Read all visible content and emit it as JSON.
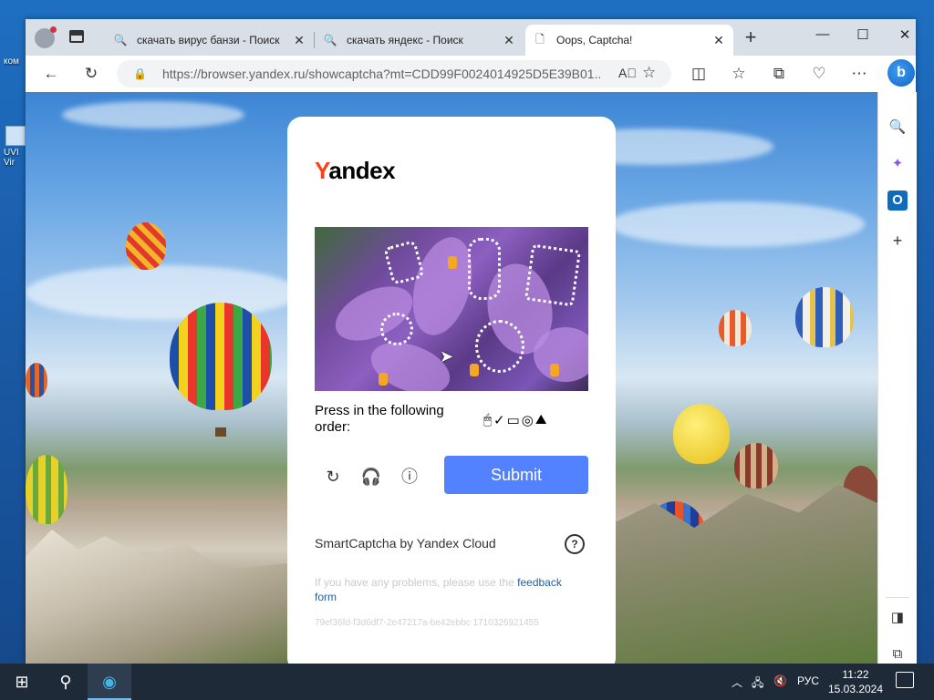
{
  "desktop": {
    "icons": [
      {
        "label": "ком"
      },
      {
        "label": "UVI\nVir"
      }
    ]
  },
  "tabs": [
    {
      "label": "скачать вирус банзи - Поиск",
      "icon": "search-icon"
    },
    {
      "label": "скачать яндекс - Поиск",
      "icon": "search-icon"
    },
    {
      "label": "Oops, Captcha!",
      "icon": "page-icon",
      "active": true
    }
  ],
  "window_controls": {
    "minimize": "—",
    "maximize": "☐",
    "close": "✕"
  },
  "address_bar": {
    "url": "https://browser.yandex.ru/showcaptcha?mt=CDD99F0024014925D5E39B01..."
  },
  "captcha": {
    "logo": {
      "first": "Y",
      "rest": "andex"
    },
    "instruction": "Press in the following order:",
    "order_icons": [
      "🖱",
      "✓",
      "▭",
      "◎",
      "⛰"
    ],
    "submit_label": "Submit",
    "branding": "SmartCaptcha by Yandex Cloud",
    "problems_text": "If you have any problems, please use the ",
    "feedback_link": "feedback form",
    "hash": "79ef36fd-f3d6df7-2e47217a-be42ebbc 1710326921455"
  },
  "taskbar": {
    "language": "РУС",
    "time": "11:22",
    "date": "15.03.2024"
  },
  "colors": {
    "brand_red": "#fc3f1d",
    "submit_blue": "#5282ff",
    "link_blue": "#1f5fb0"
  }
}
